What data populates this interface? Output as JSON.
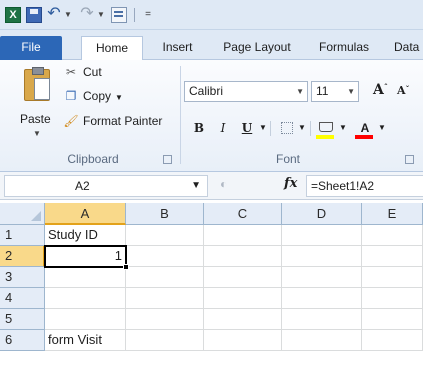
{
  "app": {
    "logo": "X"
  },
  "quick_access": {
    "undo_icon": "undo-icon",
    "redo_icon": "redo-icon",
    "customize_label": "="
  },
  "tabs": [
    "File",
    "Home",
    "Insert",
    "Page Layout",
    "Formulas",
    "Data"
  ],
  "clipboard": {
    "group_label": "Clipboard",
    "paste_label": "Paste",
    "cut_label": "Cut",
    "copy_label": "Copy",
    "format_painter_label": "Format Painter"
  },
  "font": {
    "group_label": "Font",
    "font_name": "Calibri",
    "font_size": "11",
    "bold_label": "B",
    "italic_label": "I",
    "underline_label": "U",
    "font_color_label": "A",
    "grow_label": "A",
    "shrink_label": "A",
    "fill_color": "#ffff00",
    "font_color": "#ff0000"
  },
  "formula_bar": {
    "name_box": "A2",
    "fx_label": "fx",
    "formula": "=Sheet1!A2"
  },
  "sheet": {
    "columns": [
      "A",
      "B",
      "C",
      "D",
      "E"
    ],
    "rows": [
      "1",
      "2",
      "3",
      "4",
      "5",
      "6"
    ],
    "active_column": "A",
    "active_row": "2",
    "cells": {
      "A1": "Study ID",
      "A2": "1",
      "A6": "form Visit"
    },
    "selected_cell": "A2"
  },
  "colors": {
    "file_tab": "#2c67b7",
    "header_bg": "#e4ecf7",
    "active_header": "#f9d98a"
  }
}
